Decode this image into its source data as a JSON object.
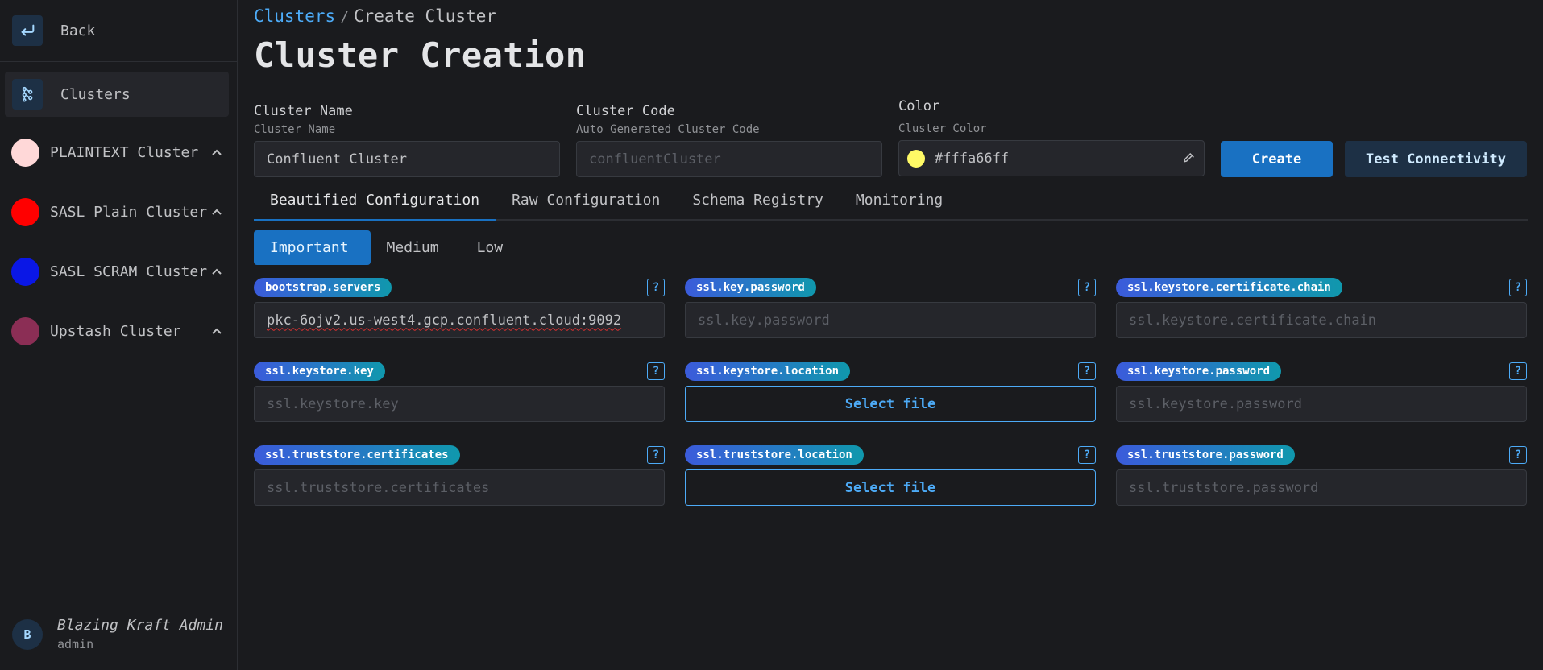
{
  "sidebar": {
    "back_label": "Back",
    "clusters_label": "Clusters",
    "clusters": [
      {
        "label": "PLAINTEXT Cluster",
        "color": "#ffd8d8"
      },
      {
        "label": "SASL Plain Cluster",
        "color": "#ff0000"
      },
      {
        "label": "SASL SCRAM Cluster",
        "color": "#0a17e6"
      },
      {
        "label": "Upstash Cluster",
        "color": "#8b2e55"
      }
    ],
    "user": {
      "initial": "B",
      "name": "Blazing Kraft Admin",
      "role": "admin"
    }
  },
  "breadcrumb": {
    "parent": "Clusters",
    "separator": "/",
    "current": "Create Cluster"
  },
  "page_title": "Cluster Creation",
  "form": {
    "cluster_name": {
      "label": "Cluster Name",
      "sublabel": "Cluster Name",
      "value": "Confluent Cluster"
    },
    "cluster_code": {
      "label": "Cluster Code",
      "sublabel": "Auto Generated Cluster Code",
      "placeholder": "confluentCluster"
    },
    "color": {
      "label": "Color",
      "sublabel": "Cluster Color",
      "value": "#fffa66ff",
      "swatch": "#fffa66"
    },
    "create_label": "Create",
    "test_label": "Test Connectivity"
  },
  "tabs": [
    "Beautified Configuration",
    "Raw Configuration",
    "Schema Registry",
    "Monitoring"
  ],
  "subtabs": [
    "Important",
    "Medium",
    "Low"
  ],
  "config": [
    {
      "key": "bootstrap.servers",
      "type": "text",
      "value": "pkc-6ojv2.us-west4.gcp.confluent.cloud:9092",
      "placeholder": ""
    },
    {
      "key": "ssl.key.password",
      "type": "text",
      "value": "",
      "placeholder": "ssl.key.password"
    },
    {
      "key": "ssl.keystore.certificate.chain",
      "type": "text",
      "value": "",
      "placeholder": "ssl.keystore.certificate.chain"
    },
    {
      "key": "ssl.keystore.key",
      "type": "text",
      "value": "",
      "placeholder": "ssl.keystore.key"
    },
    {
      "key": "ssl.keystore.location",
      "type": "file",
      "button": "Select file"
    },
    {
      "key": "ssl.keystore.password",
      "type": "text",
      "value": "",
      "placeholder": "ssl.keystore.password"
    },
    {
      "key": "ssl.truststore.certificates",
      "type": "text",
      "value": "",
      "placeholder": "ssl.truststore.certificates"
    },
    {
      "key": "ssl.truststore.location",
      "type": "file",
      "button": "Select file"
    },
    {
      "key": "ssl.truststore.password",
      "type": "text",
      "value": "",
      "placeholder": "ssl.truststore.password"
    }
  ],
  "help_glyph": "?"
}
